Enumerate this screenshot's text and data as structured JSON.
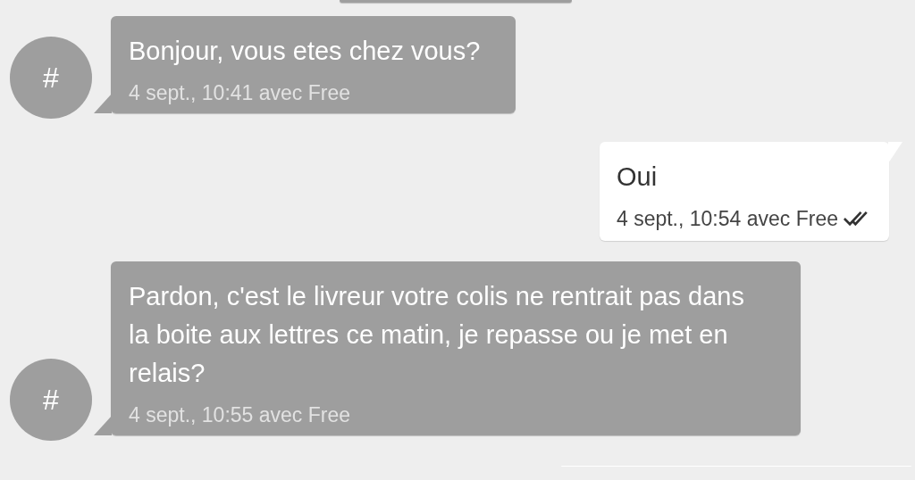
{
  "messages": [
    {
      "kind": "incoming",
      "cut": true
    },
    {
      "kind": "incoming",
      "avatar": "#",
      "text": "Bonjour, vous etes chez vous?",
      "meta": "4 sept., 10:41 avec Free"
    },
    {
      "kind": "outgoing",
      "text": "Oui",
      "meta": "4 sept., 10:54 avec Free",
      "delivered": true
    },
    {
      "kind": "incoming",
      "avatar": "#",
      "text": "Pardon, c'est le livreur votre colis ne rentrait pas dans la boite aux lettres ce matin, je repasse ou je met en relais?",
      "meta": "4 sept., 10:55 avec Free"
    },
    {
      "kind": "outgoing",
      "cut": true
    }
  ]
}
